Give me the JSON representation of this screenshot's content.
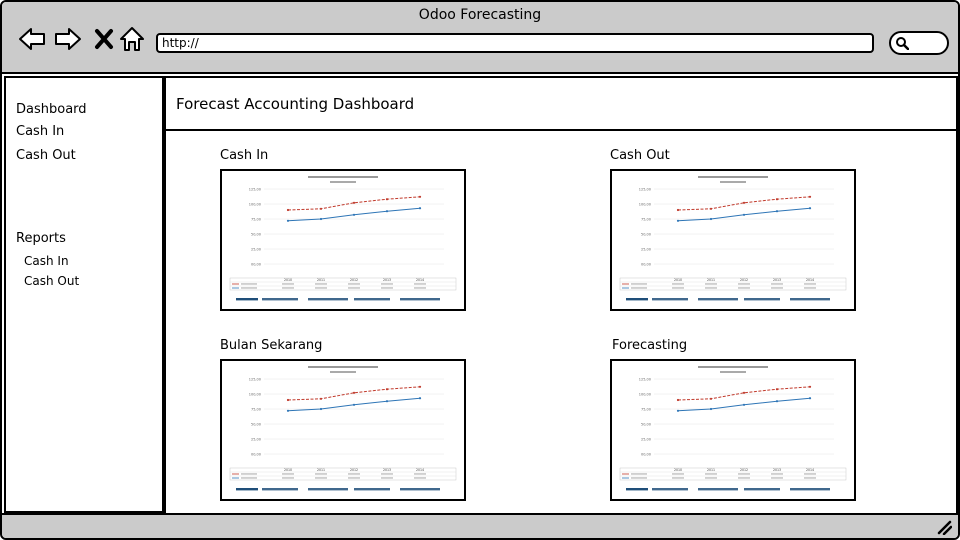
{
  "window": {
    "title": "Odoo Forecasting"
  },
  "browser": {
    "url": "http://",
    "nav_icons": [
      "back-arrow-icon",
      "forward-arrow-icon",
      "close-x-icon",
      "home-icon"
    ],
    "search_icon": "search-icon"
  },
  "sidebar": {
    "items": [
      {
        "label": "Dashboard"
      },
      {
        "label": "Cash In"
      },
      {
        "label": "Cash Out"
      }
    ],
    "reports": {
      "label": "Reports",
      "items": [
        {
          "label": "Cash In"
        },
        {
          "label": "Cash Out"
        }
      ]
    }
  },
  "header": {
    "title": "Forecast Accounting Dashboard"
  },
  "panels": [
    {
      "title": "Cash In"
    },
    {
      "title": "Cash Out"
    },
    {
      "title": "Bulan Sekarang"
    },
    {
      "title": "Forecasting"
    }
  ],
  "colors": {
    "chrome": "#cbcbcb",
    "series_red": "#c0392b",
    "series_blue": "#2e75b6",
    "chart_footer": "#1f4e79"
  },
  "chart_data": [
    {
      "type": "line",
      "categories": [
        "2010",
        "2011",
        "2012",
        "2013",
        "2014"
      ],
      "series": [
        {
          "values": [
            90,
            92,
            102,
            108,
            112
          ]
        },
        {
          "values": [
            72,
            75,
            82,
            88,
            93
          ]
        }
      ],
      "ylim": [
        0,
        125
      ],
      "yticks": [
        "125,00",
        "100,00",
        "75,00",
        "50,00",
        "25,00",
        "00,00"
      ]
    },
    {
      "type": "line",
      "categories": [
        "2010",
        "2011",
        "2012",
        "2013",
        "2014"
      ],
      "series": [
        {
          "values": [
            90,
            92,
            102,
            108,
            112
          ]
        },
        {
          "values": [
            72,
            75,
            82,
            88,
            93
          ]
        }
      ],
      "ylim": [
        0,
        125
      ],
      "yticks": [
        "125,00",
        "100,00",
        "75,00",
        "50,00",
        "25,00",
        "00,00"
      ]
    },
    {
      "type": "line",
      "categories": [
        "2010",
        "2011",
        "2012",
        "2013",
        "2014"
      ],
      "series": [
        {
          "values": [
            90,
            92,
            102,
            108,
            112
          ]
        },
        {
          "values": [
            72,
            75,
            82,
            88,
            93
          ]
        }
      ],
      "ylim": [
        0,
        125
      ],
      "yticks": [
        "125,00",
        "100,00",
        "75,00",
        "50,00",
        "25,00",
        "00,00"
      ]
    },
    {
      "type": "line",
      "categories": [
        "2010",
        "2011",
        "2012",
        "2013",
        "2014"
      ],
      "series": [
        {
          "values": [
            90,
            92,
            102,
            108,
            112
          ]
        },
        {
          "values": [
            72,
            75,
            82,
            88,
            93
          ]
        }
      ],
      "ylim": [
        0,
        125
      ],
      "yticks": [
        "125,00",
        "100,00",
        "75,00",
        "50,00",
        "25,00",
        "00,00"
      ]
    }
  ]
}
